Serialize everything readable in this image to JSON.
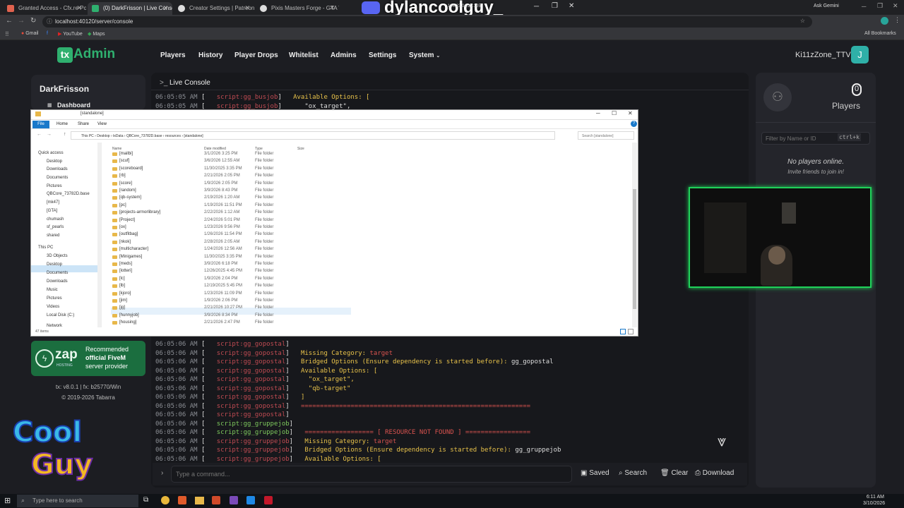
{
  "browser": {
    "tabs": [
      {
        "label": "Granted Access - Cfx.re Portal",
        "color": "#e0624e"
      },
      {
        "label": "(0) DarkFrisson | Live Console",
        "color": "#2fb06f"
      },
      {
        "label": "Creator Settings | Patreon",
        "color": "#cccccc"
      },
      {
        "label": "Pixis Masters Forge - GTA V Du",
        "color": "#cccccc"
      }
    ],
    "url": "localhost:40120/server/console",
    "bookmarks": [
      "Gmail",
      "YouTube",
      "Maps"
    ],
    "ask_gemini": "Ask Gemini",
    "all_bookmarks": "All Bookmarks"
  },
  "overlay": {
    "streamer_name": "dylancoolguy_",
    "ip_text": "104.23.0.229:105"
  },
  "header": {
    "logo_tx": "tx",
    "logo_admin": "Admin",
    "nav": [
      "Players",
      "History",
      "Player Drops",
      "Whitelist",
      "Admins",
      "Settings",
      "System"
    ],
    "username": "Ki11zZone_TTV",
    "avatar_letter": "J"
  },
  "sidebar": {
    "server_name": "DarkFrisson",
    "dashboard": "Dashboard",
    "sponsor": {
      "brand": "zap",
      "sub": "HOSTING",
      "line1": "Recommended",
      "line2": "official FiveM",
      "line3": "server provider"
    },
    "version": "tx: v8.0.1 | fx: b25770/Win",
    "copyright": "© 2019-2026 Tabarra"
  },
  "console": {
    "title": "Live Console",
    "top_lines": [
      {
        "ts": "06:05:05 AM",
        "src": "script:gg_busjob",
        "msg": "Available Options: ["
      },
      {
        "ts": "06:05:05 AM",
        "src": "script:gg_busjob",
        "msg": "  \"ox_target\","
      }
    ],
    "lines": [
      {
        "ts": "06:05:06 AM",
        "src": "script:gg_gopostal",
        "label": "",
        "msg": ""
      },
      {
        "ts": "06:05:06 AM",
        "src": "script:gg_gopostal",
        "label": "Missing Category: ",
        "msg": "target"
      },
      {
        "ts": "06:05:06 AM",
        "src": "script:gg_gopostal",
        "label": "Bridged Options (Ensure dependency is started before): ",
        "msg": "gg_gopostal"
      },
      {
        "ts": "06:05:06 AM",
        "src": "script:gg_gopostal",
        "label": "Available Options: [",
        "msg": ""
      },
      {
        "ts": "06:05:06 AM",
        "src": "script:gg_gopostal",
        "label": "  \"ox_target\",",
        "msg": ""
      },
      {
        "ts": "06:05:06 AM",
        "src": "script:gg_gopostal",
        "label": "  \"qb-target\"",
        "msg": ""
      },
      {
        "ts": "06:05:06 AM",
        "src": "script:gg_gopostal",
        "label": "]",
        "msg": ""
      },
      {
        "ts": "06:05:06 AM",
        "src": "script:gg_gopostal",
        "label": "",
        "msg": "============================================================"
      },
      {
        "ts": "06:05:06 AM",
        "src": "script:gg_gopostal",
        "label": "",
        "msg": ""
      },
      {
        "ts": "06:05:06 AM",
        "src": "script:gg_gruppejob",
        "label": "",
        "msg": ""
      },
      {
        "ts": "06:05:06 AM",
        "src": "script:gg_gruppejob",
        "label": "",
        "msg": "================== [ RESOURCE NOT FOUND ] ================="
      },
      {
        "ts": "06:05:06 AM",
        "src": "script:gg_gruppejob",
        "label": "Missing Category: ",
        "msg": "target"
      },
      {
        "ts": "06:05:06 AM",
        "src": "script:gg_gruppejob",
        "label": "Bridged Options (Ensure dependency is started before): ",
        "msg": "gg_gruppejob"
      },
      {
        "ts": "06:05:06 AM",
        "src": "script:gg_gruppejob",
        "label": "Available Options: [",
        "msg": ""
      }
    ],
    "command_placeholder": "Type a command...",
    "actions": {
      "saved": "Saved",
      "search": "Search",
      "clear": "Clear",
      "download": "Download"
    }
  },
  "players": {
    "count": "0",
    "label": "Players",
    "filter_placeholder": "Filter by Name or ID",
    "shortcut": "ctrl+k",
    "empty_title": "No players online.",
    "empty_sub": "Invite friends to join in!"
  },
  "explorer": {
    "title": "[standalone]",
    "ribbon": [
      "File",
      "Home",
      "Share",
      "View"
    ],
    "breadcrumb": [
      "This PC",
      "Desktop",
      "txData",
      "QBCore_73782D.base",
      "resources",
      "[standalone]"
    ],
    "search_placeholder": "Search [standalone]",
    "columns": [
      "Name",
      "Date modified",
      "Type",
      "Size"
    ],
    "nav_items": [
      "Quick access",
      "Desktop",
      "Downloads",
      "Documents",
      "Pictures",
      "QBCore_73782D.base",
      "[mk47]",
      "[GTA]",
      "chumash",
      "sf_pearls",
      "shared",
      "This PC",
      "3D Objects",
      "Desktop",
      "Documents",
      "Downloads",
      "Music",
      "Pictures",
      "Videos",
      "Local Disk (C:)",
      "Network"
    ],
    "rows": [
      {
        "name": "[mailbi]",
        "date": "3/1/2026 3:25 PM",
        "type": "File folder"
      },
      {
        "name": "[scuf]",
        "date": "3/6/2026 12:55 AM",
        "type": "File folder"
      },
      {
        "name": "[scoreboard]",
        "date": "11/30/2025 3:35 PM",
        "type": "File folder"
      },
      {
        "name": "[rb]",
        "date": "2/21/2026 2:05 PM",
        "type": "File folder"
      },
      {
        "name": "[score]",
        "date": "1/9/2026 2:05 PM",
        "type": "File folder"
      },
      {
        "name": "[random]",
        "date": "3/9/2026 8:43 PM",
        "type": "File folder"
      },
      {
        "name": "[qb-system]",
        "date": "2/19/2026 1:20 AM",
        "type": "File folder"
      },
      {
        "name": "[pc]",
        "date": "1/19/2026 11:51 PM",
        "type": "File folder"
      },
      {
        "name": "[projects-armorlibrary]",
        "date": "2/22/2026 1:12 AM",
        "type": "File folder"
      },
      {
        "name": "[Project]",
        "date": "2/24/2026 5:01 PM",
        "type": "File folder"
      },
      {
        "name": "[ox]",
        "date": "1/23/2026 9:56 PM",
        "type": "File folder"
      },
      {
        "name": "[outfitbag]",
        "date": "1/26/2026 11:54 PM",
        "type": "File folder"
      },
      {
        "name": "[nkok]",
        "date": "2/28/2026 2:05 AM",
        "type": "File folder"
      },
      {
        "name": "[multicharacter]",
        "date": "1/24/2026 12:56 AM",
        "type": "File folder"
      },
      {
        "name": "[Minigames]",
        "date": "11/30/2025 3:35 PM",
        "type": "File folder"
      },
      {
        "name": "[meds]",
        "date": "3/9/2026 6:18 PM",
        "type": "File folder"
      },
      {
        "name": "[lotteri]",
        "date": "12/26/2025 4:45 PM",
        "type": "File folder"
      },
      {
        "name": "[lc]",
        "date": "1/9/2026 2:04 PM",
        "type": "File folder"
      },
      {
        "name": "[lb]",
        "date": "12/19/2025 5:45 PM",
        "type": "File folder"
      },
      {
        "name": "[kjoro]",
        "date": "1/23/2026 11:09 PM",
        "type": "File folder"
      },
      {
        "name": "[jim]",
        "date": "1/9/2026 2:06 PM",
        "type": "File folder"
      },
      {
        "name": "[jg]",
        "date": "2/21/2026 10:27 PM",
        "type": "File folder"
      },
      {
        "name": "[hunnyjob]",
        "date": "3/9/2026 8:34 PM",
        "type": "File folder"
      },
      {
        "name": "[housing]",
        "date": "2/21/2026 2:47 PM",
        "type": "File folder"
      }
    ],
    "item_count": "47 items"
  },
  "taskbar": {
    "search_placeholder": "Type here to search",
    "time": "6:11 AM",
    "date": "3/10/2026"
  }
}
